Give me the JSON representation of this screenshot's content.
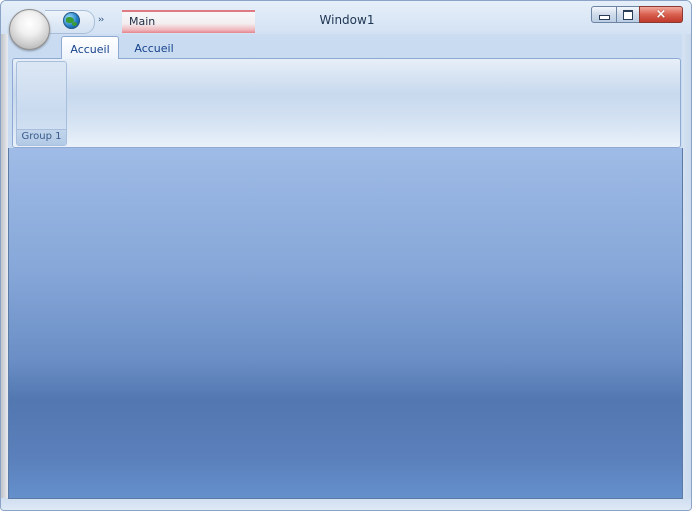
{
  "window": {
    "title": "Window1"
  },
  "quick_access": {
    "icons": [
      "globe-icon"
    ],
    "more_label": "››"
  },
  "contextual_tab": {
    "label": "Main",
    "color": "#e6848c"
  },
  "ribbon": {
    "tabs": [
      {
        "label": "Accueil",
        "selected": true
      },
      {
        "label": "Accueil",
        "selected": false
      }
    ],
    "groups": [
      {
        "label": "Group 1"
      }
    ]
  },
  "caption_buttons": {
    "close_icon": "×"
  }
}
